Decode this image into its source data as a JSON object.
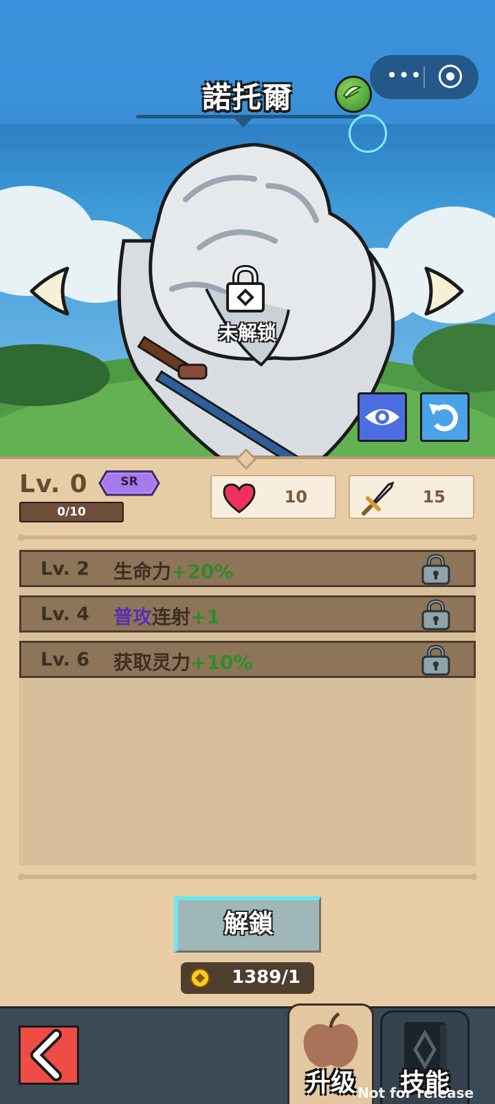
{
  "header": {
    "title": "諾托爾",
    "element_icon": "leaf-element-icon"
  },
  "miniprogram_capsule": {
    "more_icon": "more-dots-icon",
    "close_icon": "target-close-icon"
  },
  "character": {
    "lock_status": "未解锁"
  },
  "stats": {
    "level": "Lv. 0",
    "rarity": "SR",
    "exp": "0/10",
    "hp": "10",
    "attack": "15"
  },
  "skills": [
    {
      "level": "Lv. 2",
      "desc": [
        {
          "text": "生命力",
          "color": "default"
        },
        {
          "text": "+20%",
          "color": "green"
        }
      ]
    },
    {
      "level": "Lv. 4",
      "desc": [
        {
          "text": "普攻",
          "color": "purple"
        },
        {
          "text": "连射",
          "color": "default"
        },
        {
          "text": "+1",
          "color": "green"
        }
      ]
    },
    {
      "level": "Lv. 6",
      "desc": [
        {
          "text": "获取灵力",
          "color": "default"
        },
        {
          "text": "+10%",
          "color": "green"
        }
      ]
    }
  ],
  "unlock": {
    "button_label": "解鎖",
    "cost": "1389/1"
  },
  "tabs": {
    "upgrade": "升级",
    "skill": "技能"
  },
  "watermark": "Not for release",
  "colors": {
    "green": "#2f8b2e",
    "purple": "#5a2fae",
    "text": "#3d2f24"
  }
}
